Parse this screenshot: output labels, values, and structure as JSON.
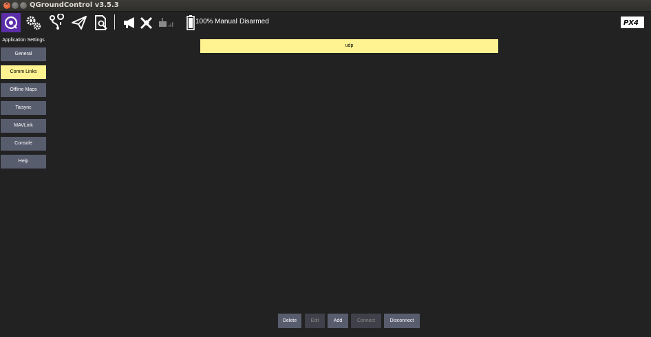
{
  "window": {
    "title": "QGroundControl v3.5.3"
  },
  "toolbar": {
    "battery_percent": "100%",
    "flight_mode": "Manual",
    "arm_status": "Disarmed",
    "icons": [
      "qgc-home-icon",
      "settings-gears-icon",
      "plan-waypoint-icon",
      "fly-paper-plane-icon",
      "analyze-document-icon",
      "messages-megaphone-icon",
      "gps-satellite-icon",
      "rc-signal-icon",
      "battery-icon",
      "px4-logo"
    ]
  },
  "sidebar": {
    "title": "Application Settings",
    "items": [
      {
        "label": "General",
        "active": false
      },
      {
        "label": "Comm Links",
        "active": true
      },
      {
        "label": "Offline Maps",
        "active": false
      },
      {
        "label": "Taisync",
        "active": false
      },
      {
        "label": "MAVLink",
        "active": false
      },
      {
        "label": "Console",
        "active": false
      },
      {
        "label": "Help",
        "active": false
      }
    ]
  },
  "links": [
    {
      "name": "udp",
      "selected": true
    }
  ],
  "actions": {
    "delete": "Delete",
    "edit": "Edit",
    "add": "Add",
    "connect": "Connect",
    "disconnect": "Disconnect"
  },
  "colors": {
    "background": "#222222",
    "button": "#585d6e",
    "button_disabled": "#3f4049",
    "selected": "#fff291",
    "accent_purple": "#5b2ea8"
  }
}
